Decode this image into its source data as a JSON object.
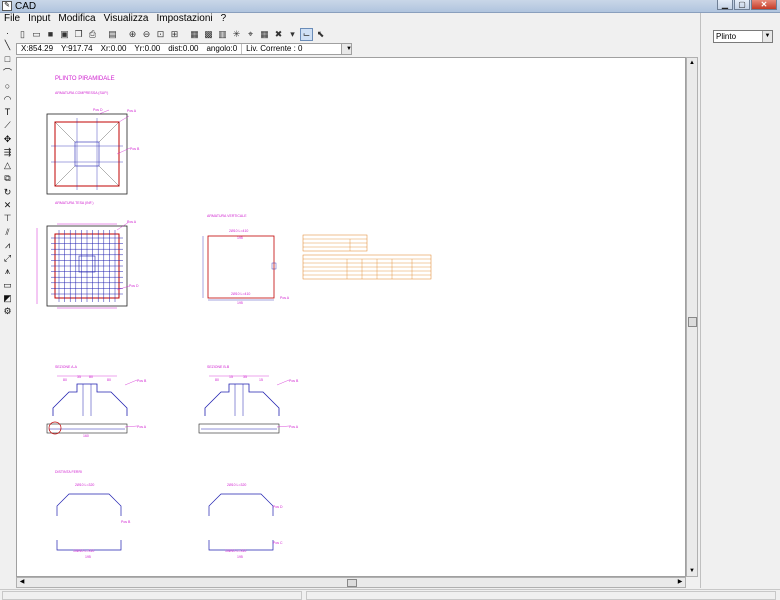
{
  "window": {
    "title": "CAD"
  },
  "menu": [
    "File",
    "Input",
    "Modifica",
    "Visualizza",
    "Impostazioni",
    "?"
  ],
  "menu_underline": [
    "F",
    "I",
    "M",
    "V",
    "I",
    "?"
  ],
  "status": {
    "x": "X:854.29",
    "y": "Y:917.74",
    "xr": "Xr:0.00",
    "yr": "Yr:0.00",
    "dist": "dist:0.00",
    "angolo": "angolo:0",
    "livello": "Liv. Corrente : 0"
  },
  "layer_select": {
    "value": "Plinto"
  },
  "drawing": {
    "title": "PLINTO PIRAMIDALE",
    "armatura_compressa": "ARMATURA COMPRESSA (SUP.)",
    "armatura_tesa": "ARMATURA TESA (INF.)",
    "armatura_verticale": "ARMATURA VERTICALE",
    "sezione_aa": "SEZIONE A-A",
    "sezione_bb": "SEZIONE B-B",
    "distinta_ferri": "DISTINTA FERRI",
    "pos_a": "Pos A",
    "pos_b": "Pos B",
    "pos_c": "Pos C",
    "pos_d": "Pos D",
    "stirrup_top": "2Ø10 L=410",
    "stirrup_bottom": "2Ø10 L=410",
    "dim_top": "195",
    "dim_side": "160",
    "bar_top_a": "2Ø10 L=320",
    "bar_top_b": "2Ø10 L=320",
    "bar_bottom_a": "10Ø10 L=310",
    "bar_bottom_b": "10Ø10 L=310",
    "dim_a": "80",
    "dim_b": "35",
    "dim_c": "80",
    "dim_d": "80",
    "dim_e": "15"
  },
  "icons": {
    "toolbar": [
      "new-file-icon",
      "open-icon",
      "save-icon",
      "save-as-icon",
      "copy-icon",
      "print-icon",
      "print-preview-icon",
      "zoom-in-icon",
      "zoom-out-icon",
      "zoom-window-icon",
      "zoom-extents-icon",
      "image-icon",
      "grid-icon",
      "layers-icon",
      "snap-icon",
      "ortho-icon",
      "table-icon",
      "delete-icon",
      "dropdown-arrow-icon",
      "coords-icon",
      "select-icon"
    ],
    "left": [
      "point-icon",
      "line-icon",
      "rectangle-icon",
      "arc-icon",
      "circle-icon",
      "arc3-icon",
      "text-icon",
      "dimension-icon",
      "move-icon",
      "copy-move-icon",
      "mirror-icon",
      "array-icon",
      "rotate-icon",
      "delete-x-icon",
      "trim-icon",
      "extend-icon",
      "hatch-icon",
      "dim-linear-icon",
      "dim-aligned-icon",
      "measure-icon",
      "layer-icon",
      "properties-icon"
    ]
  },
  "colors": {
    "drawing_magenta": "#d020d0",
    "drawing_red": "#c00000",
    "drawing_blue": "#2020b0",
    "table_orange": "#e08020"
  }
}
